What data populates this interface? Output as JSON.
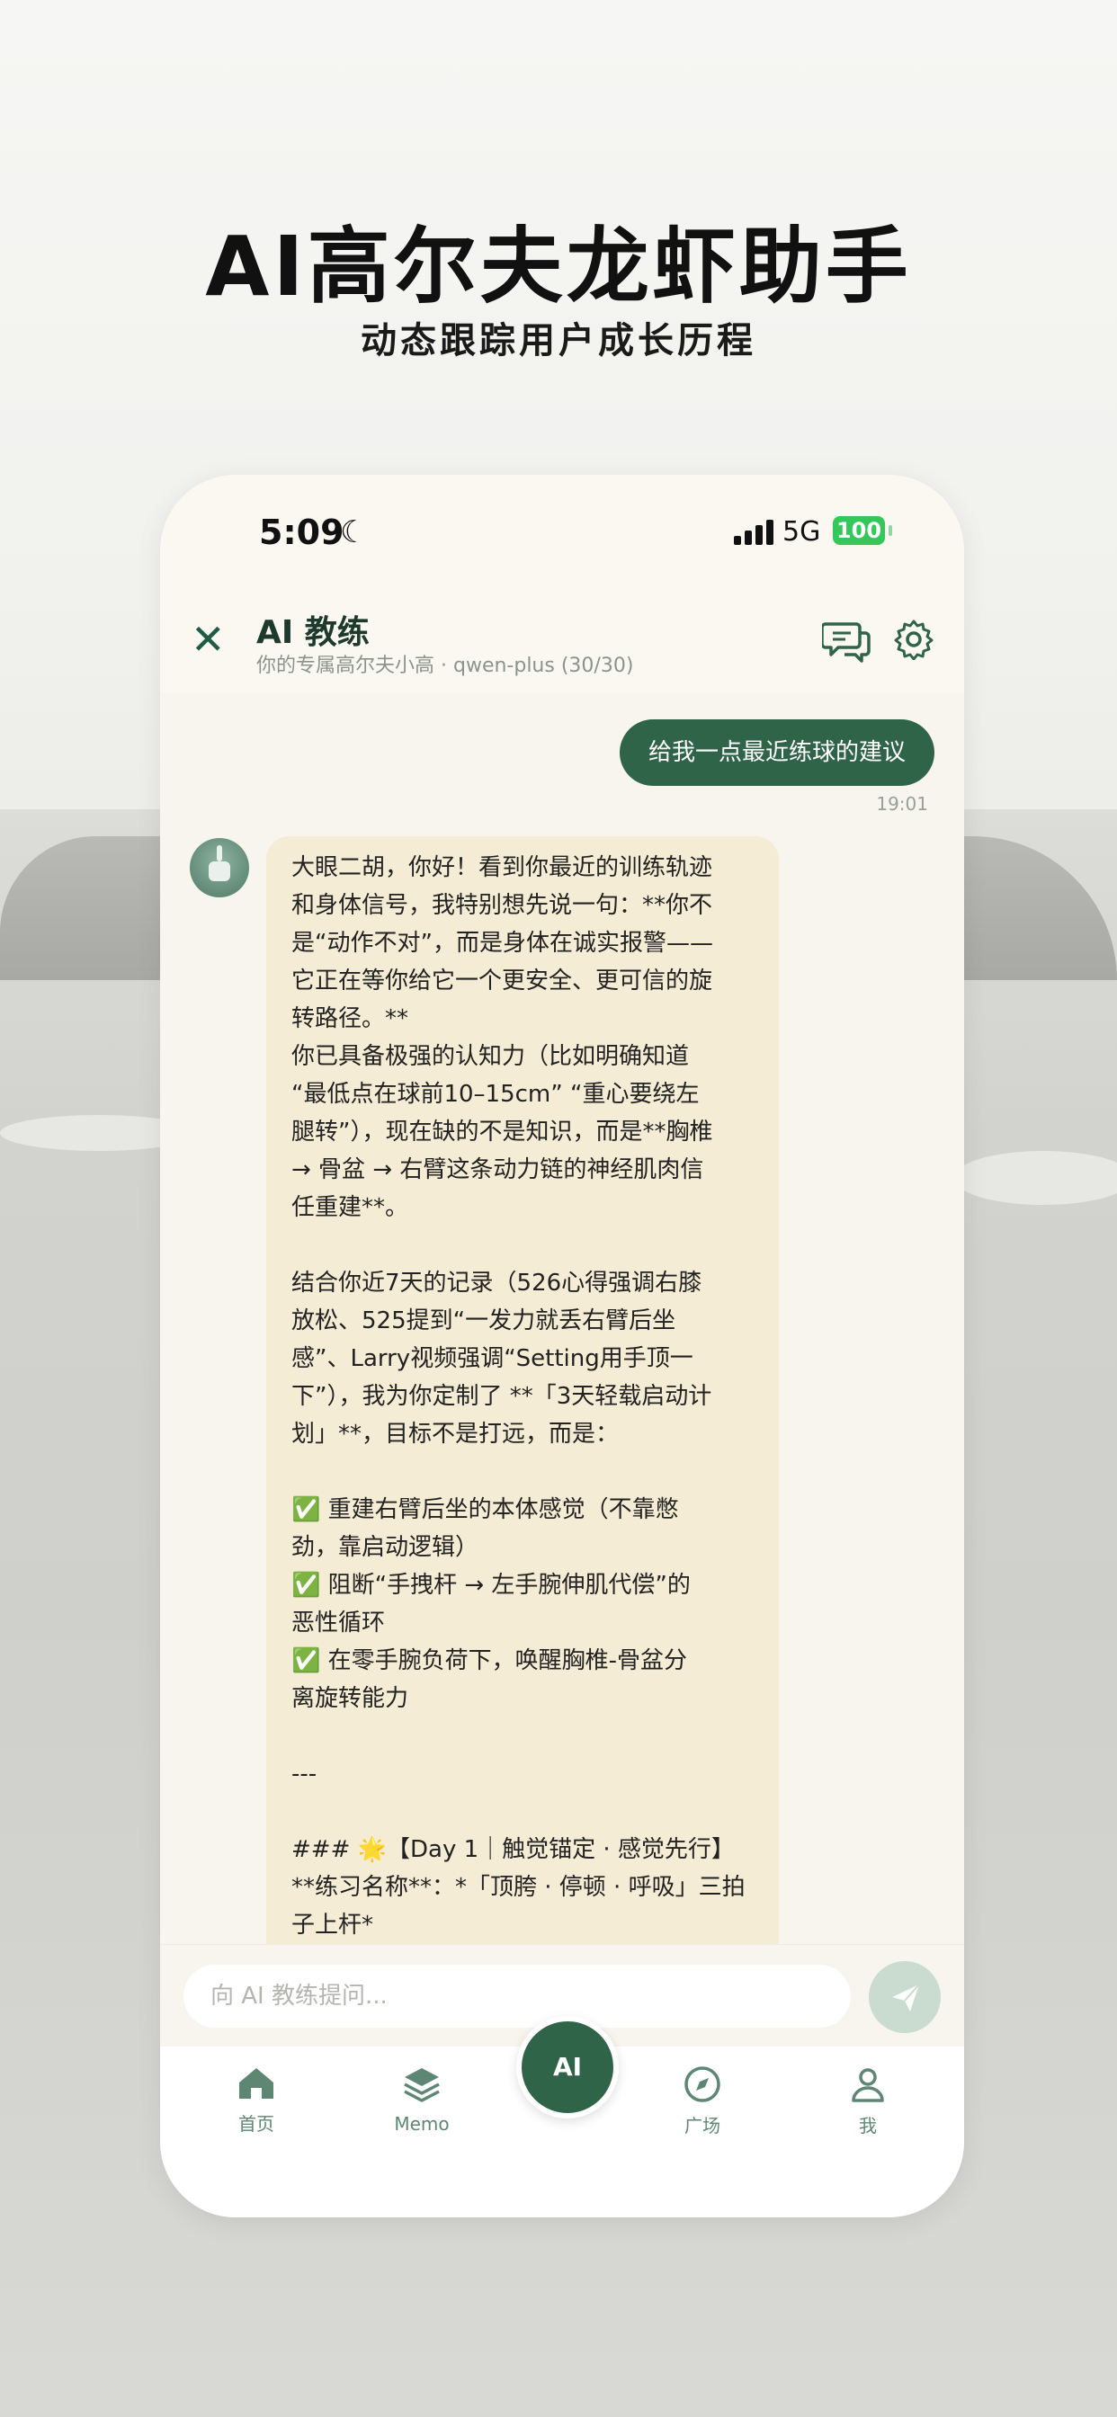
{
  "promo": {
    "title": "AI高尔夫龙虾助手",
    "subtitle": "动态跟踪用户成长历程"
  },
  "status_bar": {
    "time": "5:09",
    "network": "5G",
    "battery": "100"
  },
  "header": {
    "title": "AI 教练",
    "subtitle": "你的专属高尔夫小高 · qwen-plus (30/30)"
  },
  "chat": {
    "user_message": "给我一点最近练球的建议",
    "user_time": "19:01",
    "ai_lines": [
      "大眼二胡，你好！看到你最近的训练轨迹",
      "和身体信号，我特别想先说一句：**你不",
      "是“动作不对”，而是身体在诚实报警——",
      "它正在等你给它一个更安全、更可信的旋",
      "转路径。**",
      "你已具备极强的认知力（比如明确知道",
      "“最低点在球前10–15cm” “重心要绕左",
      "腿转”），现在缺的不是知识，而是**胸椎",
      "→ 骨盆 → 右臂这条动力链的神经肌肉信",
      "任重建**。",
      "",
      "结合你近7天的记录（526心得强调右膝",
      "放松、525提到“一发力就丢右臂后坐",
      "感”、Larry视频强调“Setting用手顶一",
      "下”），我为你定制了 **「3天轻载启动计",
      "划」**，目标不是打远，而是：",
      "",
      "✅ 重建右臂后坐的本体感觉（不靠憋",
      "劲，靠启动逻辑）",
      "✅ 阻断“手拽杆 → 左手腕伸肌代偿”的",
      "恶性循环",
      "✅ 在零手腕负荷下，唤醒胸椎-骨盆分",
      "离旋转能力",
      "",
      "---",
      "",
      "### 🌟【Day 1｜触觉锚定 · 感觉先行】",
      "**练习名称**：*「顶胯 · 停顿 · 呼吸」三拍",
      "子上杆*"
    ]
  },
  "input": {
    "placeholder": "向 AI 教练提问..."
  },
  "tabs": {
    "home": "首页",
    "memo": "Memo",
    "ai": "AI",
    "square": "广场",
    "me": "我"
  },
  "colors": {
    "brand_green": "#2f6448",
    "user_bubble": "#2f6448",
    "ai_bubble": "#f4ecd4",
    "battery_green": "#34c759"
  },
  "icons": [
    "close-icon",
    "chat-bubbles-icon",
    "gear-icon",
    "send-icon",
    "home-icon",
    "layers-icon",
    "compass-icon",
    "user-icon",
    "moon-icon",
    "signal-icon"
  ]
}
